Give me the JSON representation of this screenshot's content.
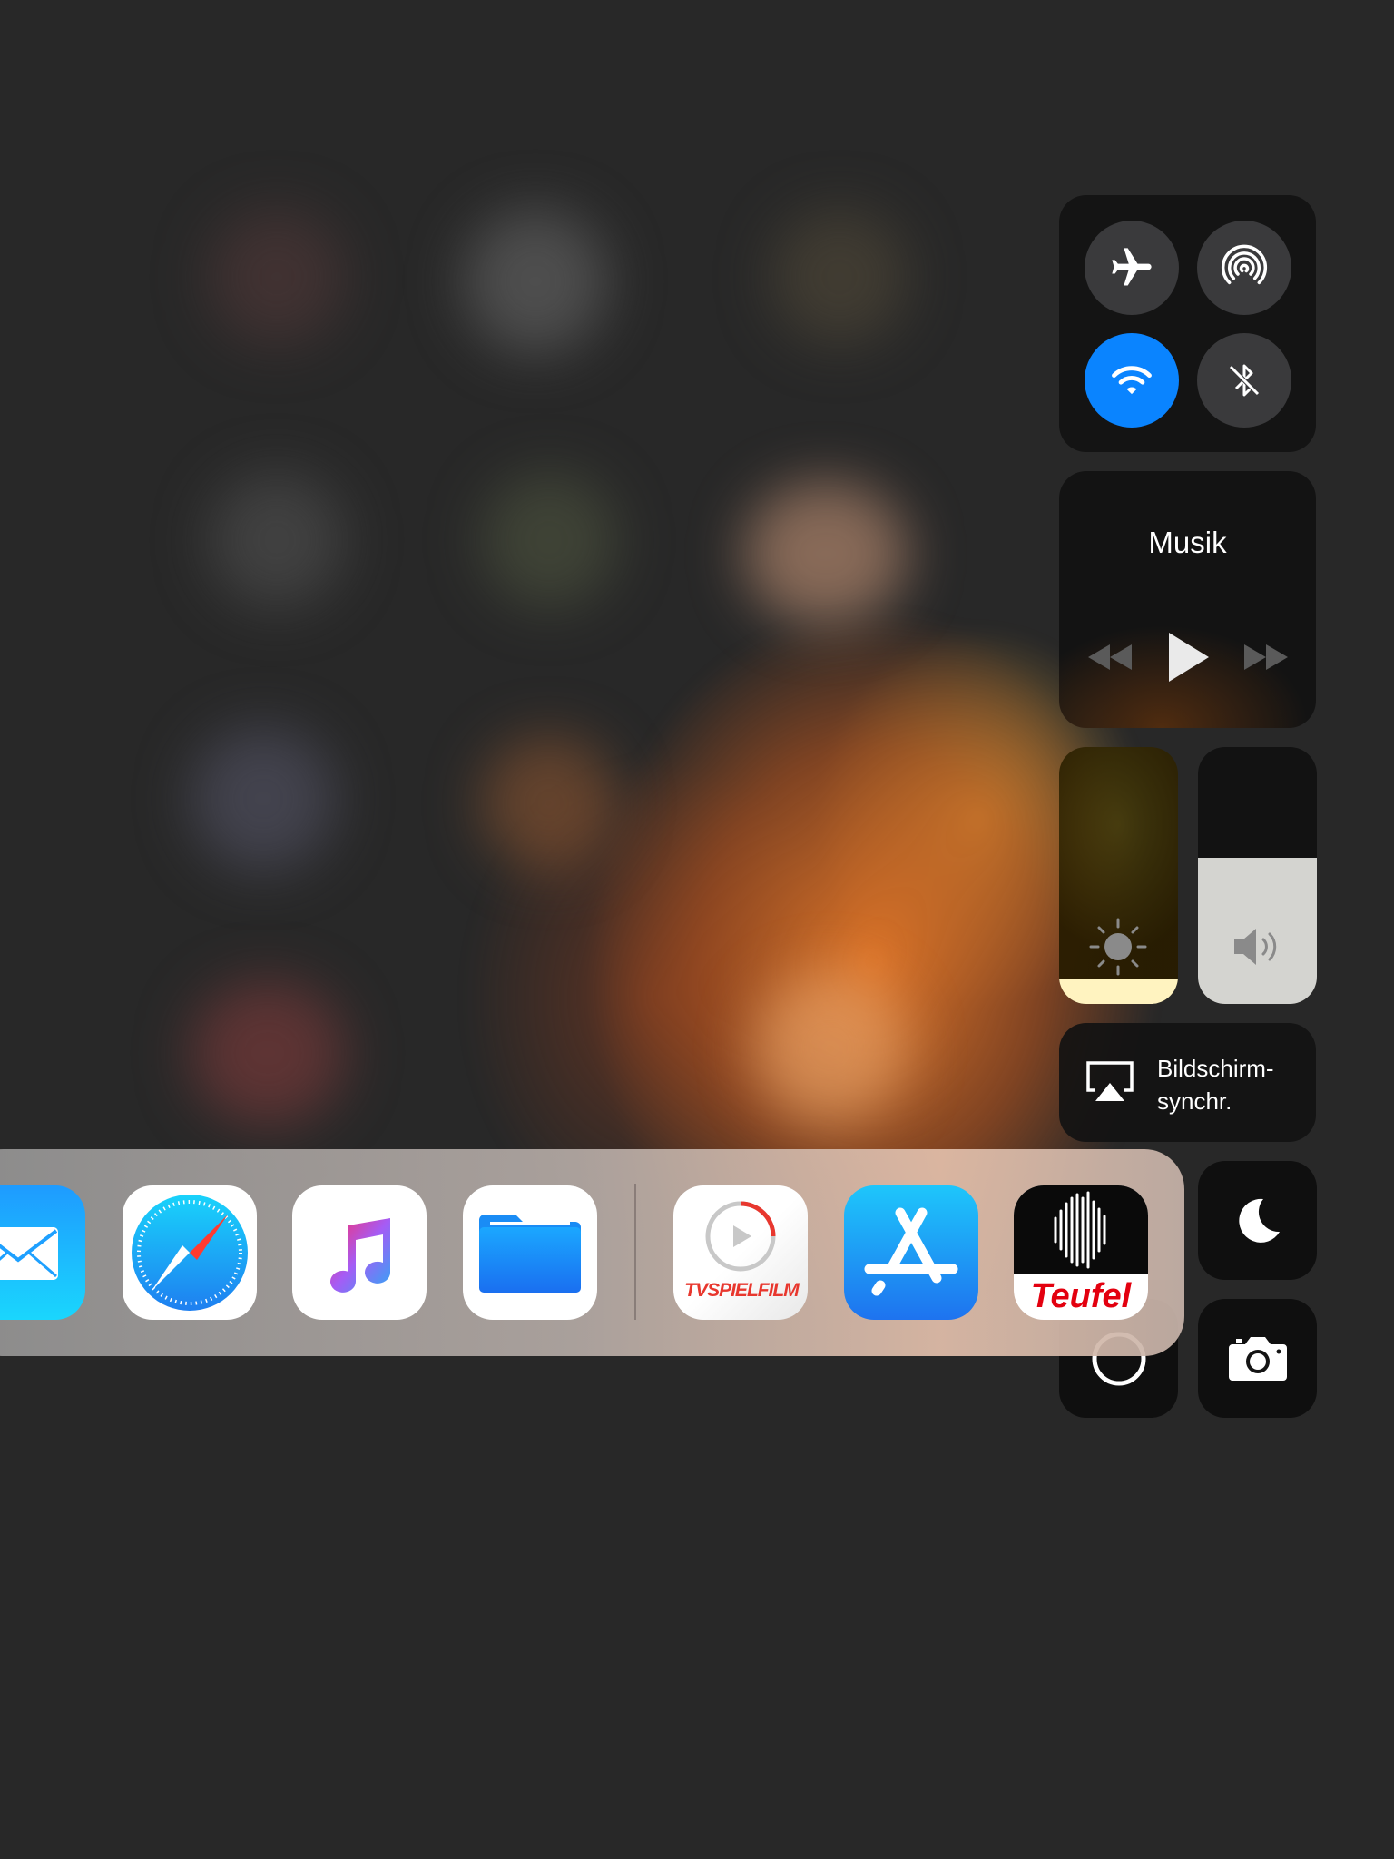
{
  "control_center": {
    "connectivity": {
      "airplane": {
        "icon": "airplane-icon",
        "active": false
      },
      "airdrop": {
        "icon": "airdrop-icon",
        "active": false
      },
      "wifi": {
        "icon": "wifi-icon",
        "active": true,
        "color": "#0a84ff"
      },
      "bluetooth": {
        "icon": "bluetooth-icon",
        "active": false
      }
    },
    "music": {
      "title": "Musik",
      "controls": [
        "rewind-icon",
        "play-icon",
        "fast-forward-icon"
      ]
    },
    "brightness": {
      "icon": "sun-icon",
      "level": 0.1
    },
    "volume": {
      "icon": "speaker-icon",
      "level": 0.57
    },
    "screen_mirroring": {
      "icon": "airplay-icon",
      "label": "Bildschirm-\nsynchr."
    },
    "do_not_disturb": {
      "icon": "moon-icon"
    },
    "rotation_lock": {
      "icon": "rotation-lock-icon"
    },
    "camera": {
      "icon": "camera-icon"
    }
  },
  "dock": {
    "apps": [
      {
        "name": "Mail",
        "icon": "mail-icon"
      },
      {
        "name": "Safari",
        "icon": "safari-icon"
      },
      {
        "name": "Musik",
        "icon": "music-icon"
      },
      {
        "name": "Dateien",
        "icon": "files-icon"
      },
      {
        "name": "TV Spielfilm",
        "icon": "tvspielfilm-icon",
        "logo_text": "TVSPIELFILM"
      },
      {
        "name": "App Store",
        "icon": "app-store-icon"
      },
      {
        "name": "Teufel",
        "icon": "teufel-icon",
        "logo_text": "Teufel"
      }
    ]
  }
}
